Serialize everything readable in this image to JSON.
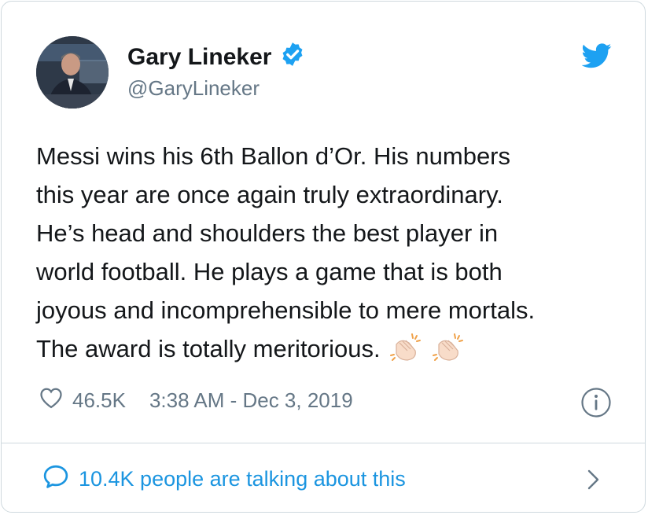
{
  "author": {
    "name": "Gary Lineker",
    "handle": "@GaryLineker",
    "verified": true
  },
  "tweet": {
    "lines": [
      "Messi wins his 6th Ballon d’Or. His numbers",
      "this year are once again truly extraordinary.",
      "He’s head and shoulders the best player in",
      "world football. He plays a game that is both",
      "joyous and incomprehensible to mere mortals.",
      "The award is totally meritorious."
    ],
    "emoji": [
      "clapping-hands",
      "clapping-hands"
    ]
  },
  "meta": {
    "likes": "46.5K",
    "timestamp": "3:38 AM - Dec 3, 2019"
  },
  "footer": {
    "talking": "10.4K people are talking about this"
  },
  "colors": {
    "text": "#14171a",
    "muted": "#657786",
    "accent": "#1da1f2",
    "link": "#1b95e0",
    "border": "#cfd9de"
  },
  "icons": [
    "verified-badge-icon",
    "twitter-bird-icon",
    "heart-icon",
    "info-icon",
    "speech-bubble-icon",
    "chevron-right-icon"
  ]
}
